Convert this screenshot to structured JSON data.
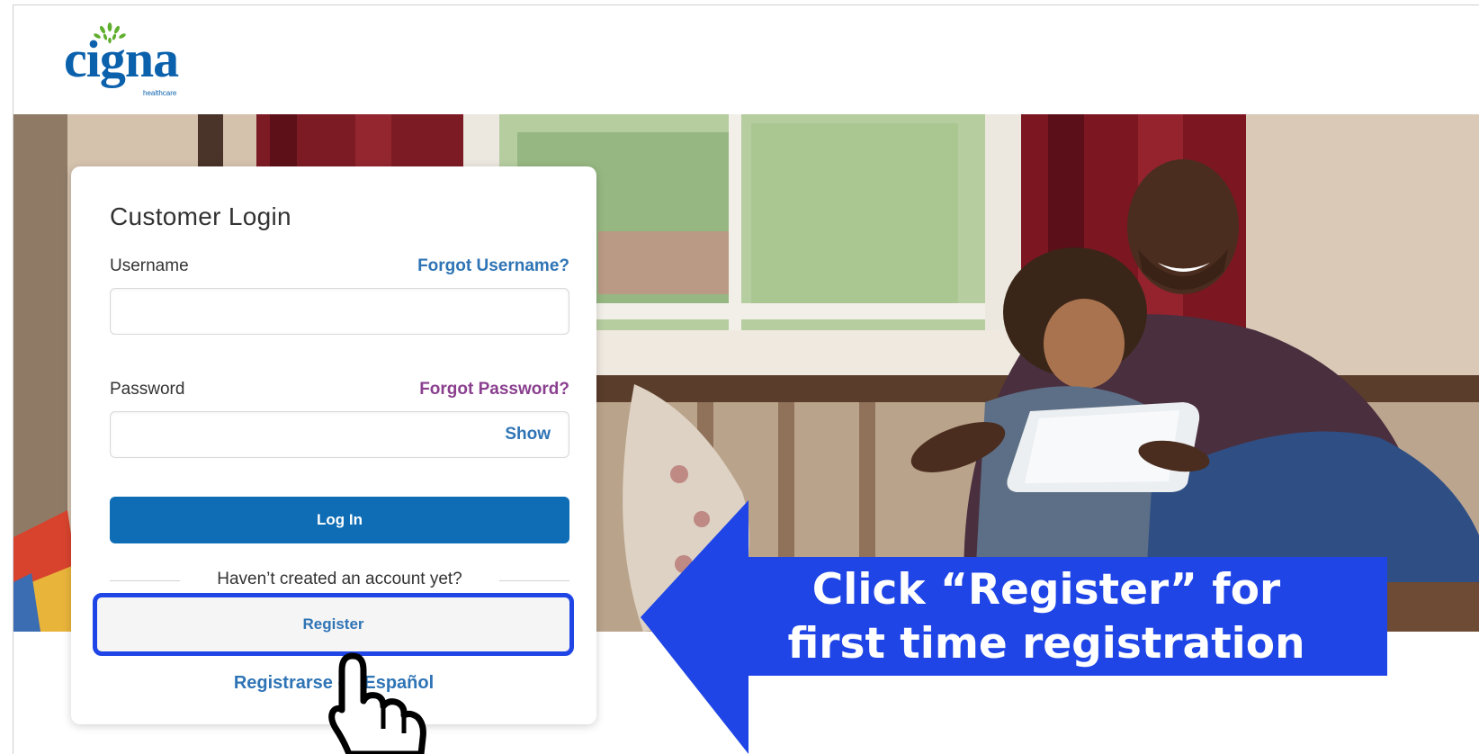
{
  "brand": {
    "name": "cigna",
    "sub": "healthcare",
    "color": "#0b61ac"
  },
  "login": {
    "title": "Customer Login",
    "username_label": "Username",
    "forgot_username": "Forgot Username?",
    "username_value": "",
    "password_label": "Password",
    "forgot_password": "Forgot Password?",
    "password_value": "",
    "show_label": "Show",
    "login_button": "Log In",
    "divider_text": "Haven’t created an account yet?",
    "register_button": "Register",
    "espanol_link": "Registrarse en Español"
  },
  "callout": {
    "line1": "Click “Register” for",
    "line2": "first time registration",
    "color": "#1f45e6"
  },
  "colors": {
    "primary_button": "#0f6db5",
    "link_blue": "#2f74b5",
    "link_purple": "#8a3f8f"
  }
}
